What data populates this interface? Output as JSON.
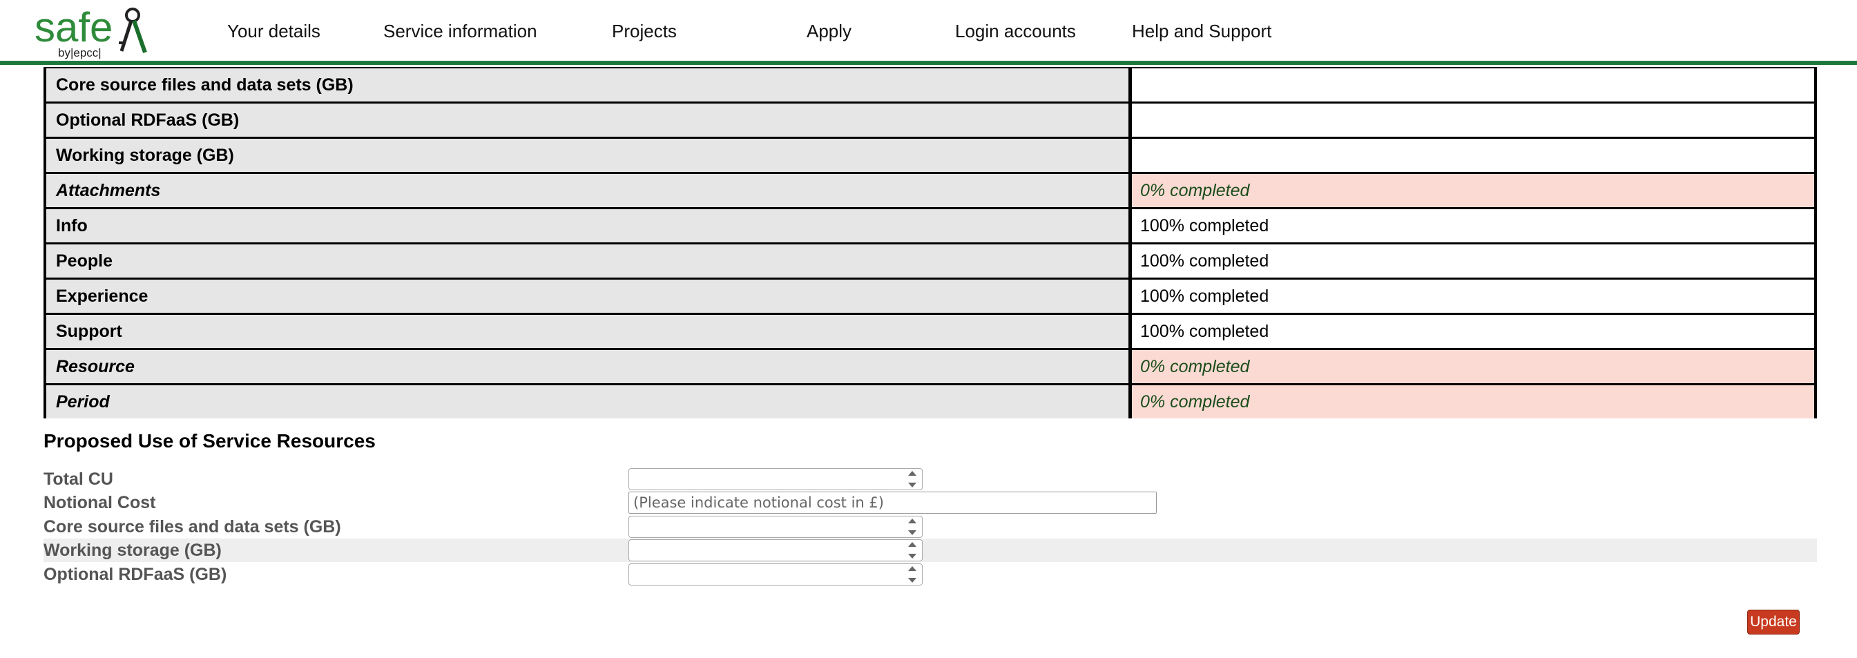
{
  "header": {
    "logo": {
      "text": "safe",
      "subtext": "by|epcc|"
    },
    "nav": [
      "Your details",
      "Service information",
      "Projects",
      "Apply",
      "Login accounts",
      "Help and Support"
    ]
  },
  "status_table": {
    "rows": [
      {
        "label": "Core source files and data sets (GB)",
        "value": "",
        "incomplete": false
      },
      {
        "label": "Optional RDFaaS (GB)",
        "value": "",
        "incomplete": false
      },
      {
        "label": "Working storage (GB)",
        "value": "",
        "incomplete": false
      },
      {
        "label": "Attachments",
        "value": "0% completed",
        "incomplete": true
      },
      {
        "label": "Info",
        "value": "100% completed",
        "incomplete": false
      },
      {
        "label": "People",
        "value": "100% completed",
        "incomplete": false
      },
      {
        "label": "Experience",
        "value": "100% completed",
        "incomplete": false
      },
      {
        "label": "Support",
        "value": "100% completed",
        "incomplete": false
      },
      {
        "label": "Resource",
        "value": "0% completed",
        "incomplete": true
      },
      {
        "label": "Period",
        "value": "0% completed",
        "incomplete": true
      }
    ]
  },
  "form": {
    "title": "Proposed Use of Service Resources",
    "fields": [
      {
        "label": "Total CU",
        "type": "number",
        "value": ""
      },
      {
        "label": "Notional Cost",
        "type": "text",
        "value": "",
        "placeholder": "(Please indicate notional cost in £)"
      },
      {
        "label": "Core source files and data sets (GB)",
        "type": "number",
        "value": ""
      },
      {
        "label": "Working storage (GB)",
        "type": "number",
        "value": ""
      },
      {
        "label": "Optional RDFaaS (GB)",
        "type": "number",
        "value": ""
      }
    ],
    "update_label": "Update"
  },
  "colors": {
    "brand_green": "#1e7a3c",
    "incomplete_bg": "#fadad3",
    "update_button": "#c83a1f"
  }
}
